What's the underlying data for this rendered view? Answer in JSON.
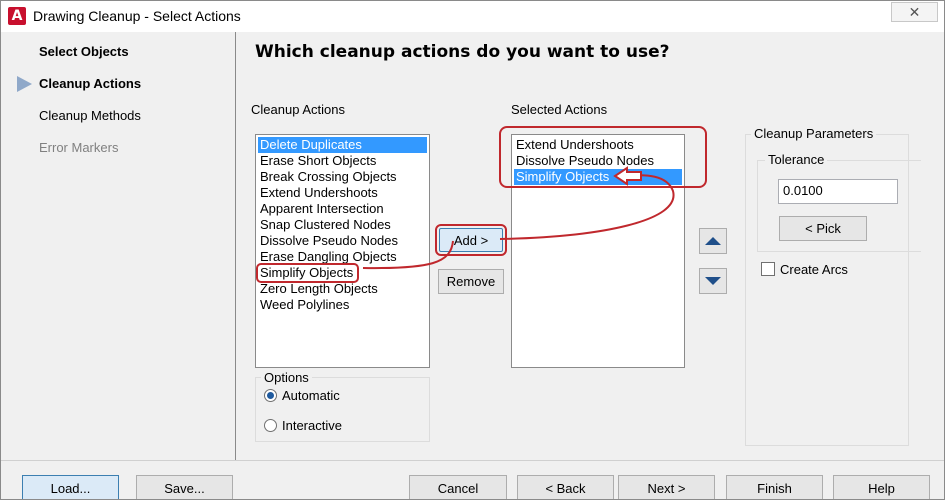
{
  "window": {
    "title": "Drawing Cleanup - Select Actions",
    "app_icon_glyph": "A",
    "close_glyph": "✕"
  },
  "steps": [
    {
      "label": "Select Objects",
      "state": "done"
    },
    {
      "label": "Cleanup Actions",
      "state": "current"
    },
    {
      "label": "Cleanup Methods",
      "state": "pending"
    },
    {
      "label": "Error Markers",
      "state": "disabled"
    }
  ],
  "main": {
    "heading": "Which cleanup actions do you want to use?",
    "cleanup_actions_label": "Cleanup Actions",
    "selected_actions_label": "Selected Actions",
    "cleanup_actions": [
      "Delete Duplicates",
      "Erase Short Objects",
      "Break Crossing Objects",
      "Extend Undershoots",
      "Apparent Intersection",
      "Snap Clustered Nodes",
      "Dissolve Pseudo Nodes",
      "Erase Dangling Objects",
      "Simplify Objects",
      "Zero Length Objects",
      "Weed Polylines"
    ],
    "selected_actions": [
      "Extend Undershoots",
      "Dissolve Pseudo Nodes",
      "Simplify Objects"
    ],
    "add_label": "Add >",
    "remove_label": "Remove",
    "options": {
      "title": "Options",
      "automatic": "Automatic",
      "interactive": "Interactive",
      "selected": "automatic"
    },
    "parameters": {
      "title": "Cleanup Parameters",
      "tolerance_title": "Tolerance",
      "tolerance_value": "0.0100",
      "pick_label": "< Pick",
      "create_arcs_label": "Create Arcs",
      "create_arcs_checked": false
    }
  },
  "footer": {
    "load": "Load...",
    "save": "Save...",
    "cancel": "Cancel",
    "back": "< Back",
    "next": "Next >",
    "finish": "Finish",
    "help": "Help"
  },
  "colors": {
    "selection": "#3399ff",
    "annotation": "#c0282d",
    "step_arrow": "#8fa8c9"
  }
}
